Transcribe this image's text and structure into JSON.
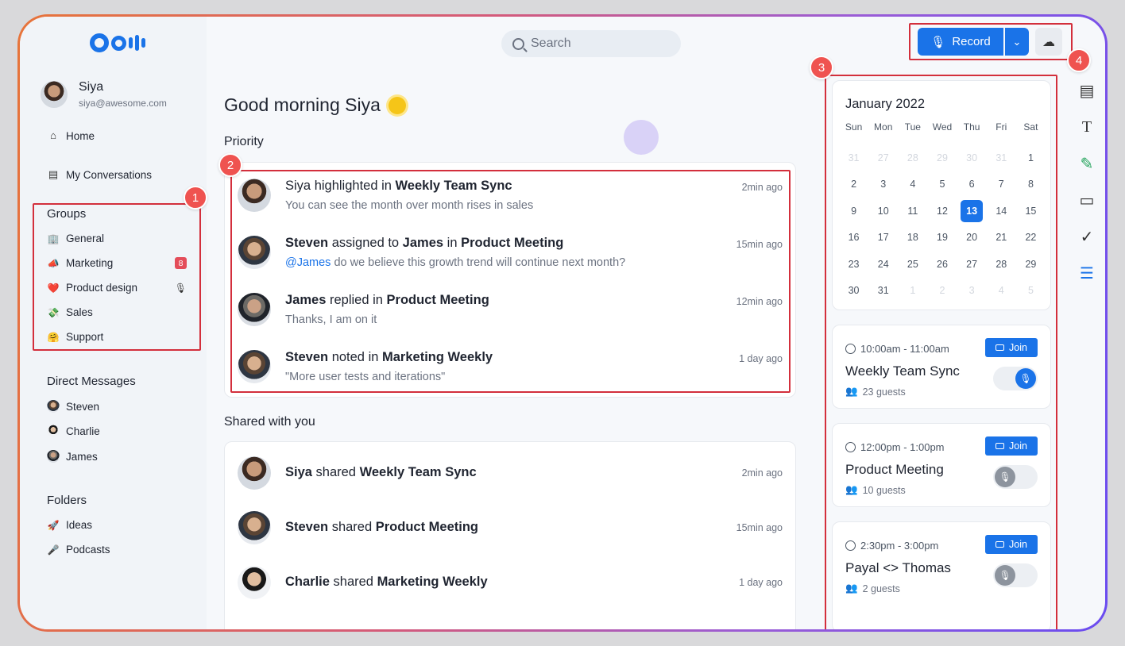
{
  "search": {
    "placeholder": "Search"
  },
  "toolbar": {
    "record_label": "Record"
  },
  "user": {
    "name": "Siya",
    "email": "siya@awesome.com"
  },
  "nav": {
    "home": "Home",
    "conversations": "My Conversations"
  },
  "groups": {
    "title": "Groups",
    "items": [
      {
        "label": "General",
        "emoji": "🏢"
      },
      {
        "label": "Marketing",
        "emoji": "📣",
        "badge": "8"
      },
      {
        "label": "Product design",
        "emoji": "❤️"
      },
      {
        "label": "Sales",
        "emoji": "💸"
      },
      {
        "label": "Support",
        "emoji": "🤗"
      }
    ]
  },
  "direct_messages": {
    "title": "Direct Messages",
    "items": [
      {
        "label": "Steven"
      },
      {
        "label": "Charlie"
      },
      {
        "label": "James"
      }
    ]
  },
  "folders": {
    "title": "Folders",
    "items": [
      {
        "label": "Ideas",
        "emoji": "🚀"
      },
      {
        "label": "Podcasts",
        "emoji": "🎤"
      }
    ]
  },
  "main": {
    "greeting": "Good morning Siya",
    "priority_label": "Priority",
    "shared_label": "Shared with you",
    "priority": [
      {
        "actor": "Siya",
        "verb": " highlighted in ",
        "target": "Weekly Team Sync",
        "sub": "You can see the month over month rises in sales",
        "time": "2min ago"
      },
      {
        "actor": "Steven",
        "verb": " assigned to ",
        "target2": "James",
        "verb2": " in ",
        "target": "Product Meeting",
        "mention": "@James",
        "sub": " do we believe this growth trend will continue next month?",
        "time": "15min ago"
      },
      {
        "actor": "James",
        "verb": " replied in ",
        "target": "Product Meeting",
        "sub": "Thanks, I am on it",
        "time": "12min ago"
      },
      {
        "actor": "Steven",
        "verb": " noted in ",
        "target": "Marketing Weekly",
        "sub": "\"More user tests and iterations\"",
        "time": "1 day ago"
      }
    ],
    "shared": [
      {
        "actor": "Siya",
        "verb": " shared ",
        "target": "Weekly Team Sync",
        "time": "2min ago"
      },
      {
        "actor": "Steven",
        "verb": " shared ",
        "target": "Product Meeting",
        "time": "15min ago"
      },
      {
        "actor": "Charlie",
        "verb": " shared ",
        "target": "Marketing Weekly",
        "time": "1 day ago"
      }
    ]
  },
  "calendar": {
    "title": "January 2022",
    "weekdays": [
      "Sun",
      "Mon",
      "Tue",
      "Wed",
      "Thu",
      "Fri",
      "Sat"
    ],
    "days": [
      "31",
      "27",
      "28",
      "29",
      "30",
      "31",
      "1",
      "2",
      "3",
      "4",
      "5",
      "6",
      "7",
      "8",
      "9",
      "10",
      "11",
      "12",
      "13",
      "14",
      "15",
      "16",
      "17",
      "18",
      "19",
      "20",
      "21",
      "22",
      "23",
      "24",
      "25",
      "26",
      "27",
      "28",
      "29",
      "30",
      "31",
      "1",
      "2",
      "3",
      "4",
      "5"
    ]
  },
  "meetings": [
    {
      "time": "10:00am  - 11:00am",
      "title": "Weekly Team Sync",
      "guests": "23 guests",
      "join": "Join"
    },
    {
      "time": "12:00pm - 1:00pm",
      "title": "Product Meeting",
      "guests": "10 guests",
      "join": "Join"
    },
    {
      "time": "2:30pm - 3:00pm",
      "title": "Payal <> Thomas",
      "guests": "2 guests",
      "join": "Join"
    }
  ],
  "annotations": [
    "1",
    "2",
    "3",
    "4"
  ],
  "colors": {
    "accent": "#1a73e8",
    "annotation": "#ef5350",
    "badge": "#e44d5a"
  }
}
